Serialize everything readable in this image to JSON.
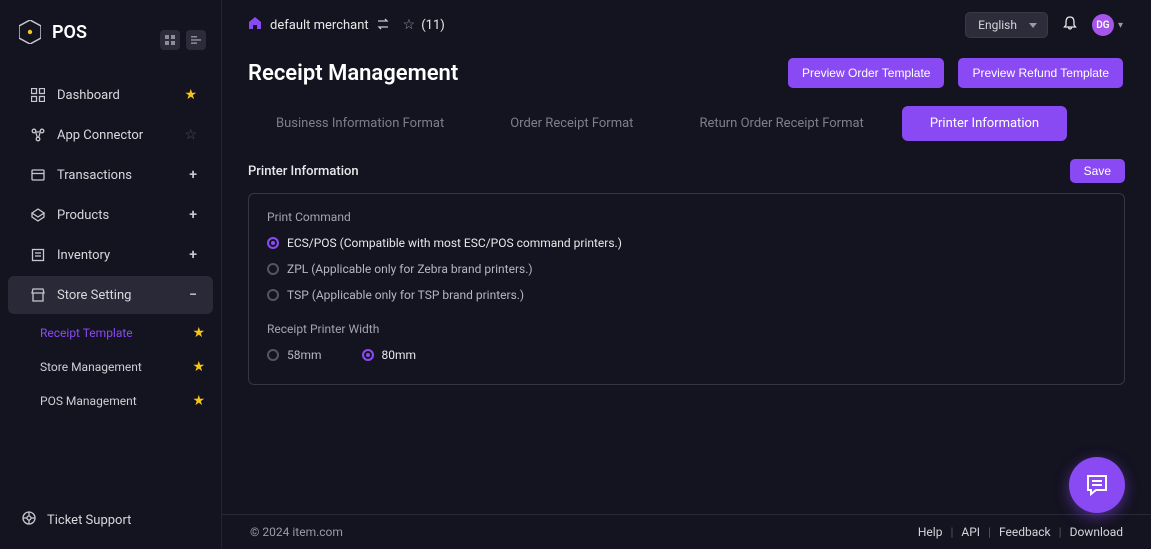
{
  "brand": {
    "title": "POS"
  },
  "topbar": {
    "merchant_label": "default merchant",
    "fav_count": "(11)",
    "language": "English",
    "avatar_initials": "DG"
  },
  "page": {
    "title": "Receipt Management",
    "preview_order": "Preview Order Template",
    "preview_refund": "Preview Refund Template"
  },
  "tabs": {
    "biz": "Business Information Format",
    "order": "Order Receipt Format",
    "return": "Return Order Receipt Format",
    "printer": "Printer Information"
  },
  "section": {
    "title": "Printer Information",
    "save": "Save"
  },
  "form": {
    "print_command_label": "Print Command",
    "options": {
      "ecs": "ECS/POS (Compatible with most ESC/POS command printers.)",
      "zpl": "ZPL (Applicable only for Zebra brand printers.)",
      "tsp": "TSP (Applicable only for TSP brand printers.)"
    },
    "width_label": "Receipt Printer Width",
    "width_58": "58mm",
    "width_80": "80mm"
  },
  "sidebar": {
    "items": {
      "dashboard": "Dashboard",
      "connector": "App Connector",
      "transactions": "Transactions",
      "products": "Products",
      "inventory": "Inventory",
      "store": "Store Setting"
    },
    "sub": {
      "receipt": "Receipt Template",
      "store_mgmt": "Store Management",
      "pos_mgmt": "POS Management"
    },
    "support": "Ticket Support"
  },
  "footer": {
    "copyright": "© 2024 item.com",
    "help": "Help",
    "api": "API",
    "feedback": "Feedback",
    "download": "Download"
  }
}
